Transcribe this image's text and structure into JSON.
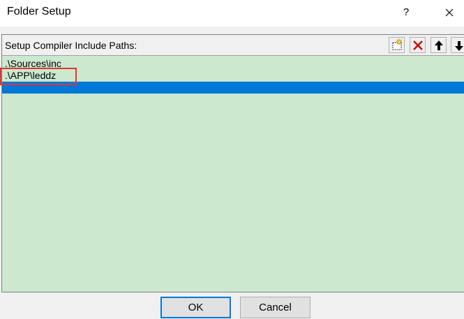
{
  "window": {
    "title": "Folder Setup",
    "help_label": "?",
    "close_icon": "close-icon"
  },
  "panel": {
    "label": "Setup Compiler Include Paths:",
    "toolbar": {
      "new_icon": "new-folder-icon",
      "delete_icon": "delete-icon",
      "move_up_icon": "arrow-up-icon",
      "move_down_icon": "arrow-down-icon"
    },
    "items": [
      {
        "path": ".\\Sources\\inc",
        "selected": false
      },
      {
        "path": ".\\APP\\leddz",
        "selected": false,
        "annotated": true
      },
      {
        "path": "",
        "selected": true
      }
    ]
  },
  "buttons": {
    "ok": "OK",
    "cancel": "Cancel"
  },
  "colors": {
    "list_background": "#cce8cf",
    "selection": "#0078d7",
    "annotation": "#e53333"
  }
}
